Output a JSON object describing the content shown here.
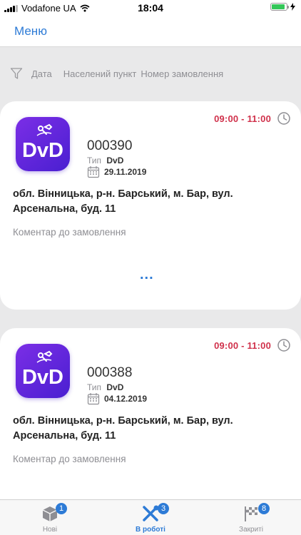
{
  "status_bar": {
    "carrier": "Vodafone UA",
    "time": "18:04"
  },
  "header": {
    "menu_label": "Меню"
  },
  "filters": [
    "Дата",
    "Населений пункт",
    "Номер замовлення"
  ],
  "orders": [
    {
      "time_range": "09:00 - 11:00",
      "logo_text": "DvD",
      "number": "000390",
      "type_label": "Тип",
      "type_value": "DvD",
      "date": "29.11.2019",
      "address": "обл. Вінницька, р-н. Барський, м. Бар, вул. Арсенальна, буд. 11",
      "comment_placeholder": "Коментар до замовлення",
      "more": "..."
    },
    {
      "time_range": "09:00 - 11:00",
      "logo_text": "DvD",
      "number": "000388",
      "type_label": "Тип",
      "type_value": "DvD",
      "date": "04.12.2019",
      "address": "обл. Вінницька, р-н. Барський, м. Бар, вул. Арсенальна, буд. 11",
      "comment_placeholder": "Коментар до замовлення"
    }
  ],
  "tabs": [
    {
      "label": "Нові",
      "badge": "1",
      "icon": "box-icon"
    },
    {
      "label": "В роботі",
      "badge": "3",
      "icon": "tools-icon",
      "active": true
    },
    {
      "label": "Закриті",
      "badge": "8",
      "icon": "finish-flag-icon"
    }
  ],
  "colors": {
    "accent": "#2d7bd6",
    "time": "#d0314b",
    "logo_start": "#7b2ee6",
    "logo_end": "#4a1fd1"
  }
}
